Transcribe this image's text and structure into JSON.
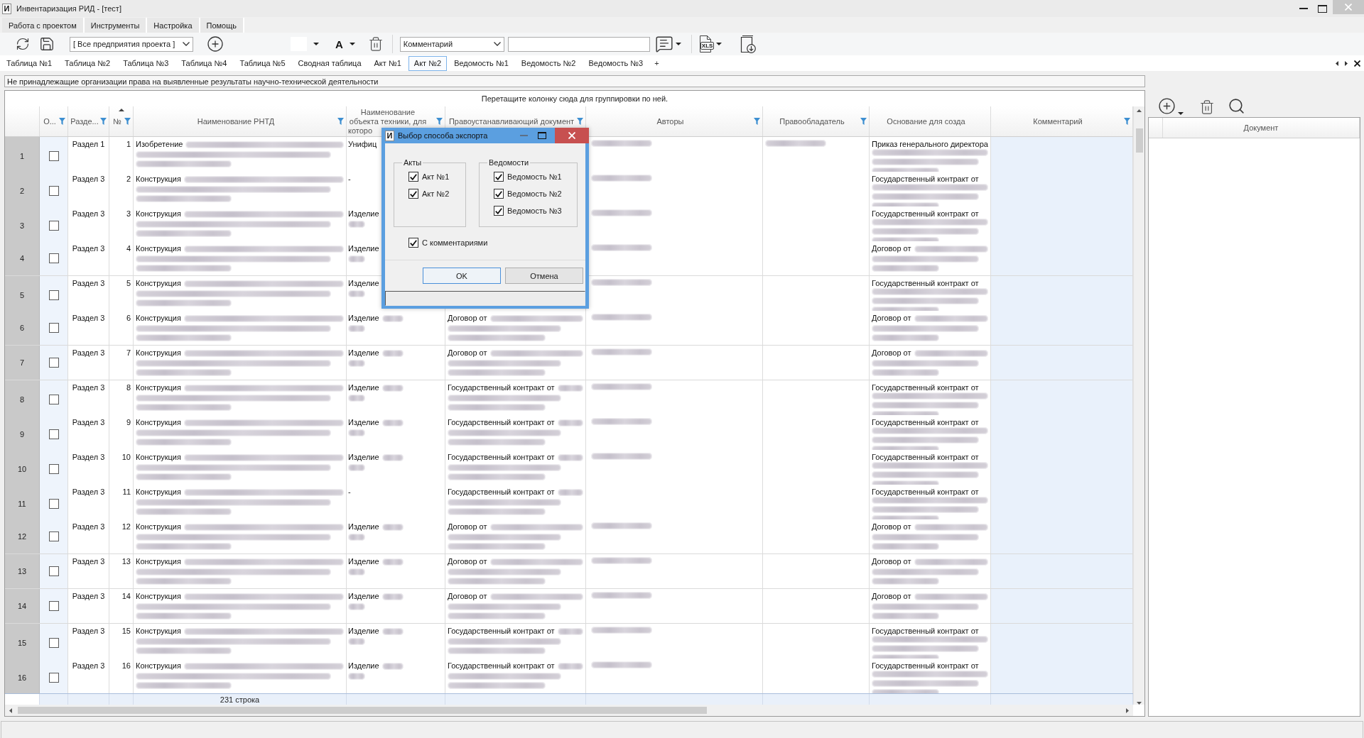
{
  "window": {
    "icon_letter": "И",
    "title": "Инвентаризация РИД - [тест]"
  },
  "menu": [
    "Работа с проектом",
    "Инструменты",
    "Настройка",
    "Помощь"
  ],
  "toolbar": {
    "project_filter": "[ Все предприятия проекта ]",
    "font_color": "A",
    "column_select": "Комментарий",
    "export_label": "XLS"
  },
  "tabs": [
    {
      "label": "Таблица №1",
      "selected": false
    },
    {
      "label": "Таблица №2",
      "selected": false
    },
    {
      "label": "Таблица №3",
      "selected": false
    },
    {
      "label": "Таблица №4",
      "selected": false
    },
    {
      "label": "Таблица №5",
      "selected": false
    },
    {
      "label": "Сводная таблица",
      "selected": false
    },
    {
      "label": "Акт №1",
      "selected": false
    },
    {
      "label": "Акт №2",
      "selected": true
    },
    {
      "label": "Ведомость №1",
      "selected": false
    },
    {
      "label": "Ведомость №2",
      "selected": false
    },
    {
      "label": "Ведомость №3",
      "selected": false
    }
  ],
  "add_tab": "+",
  "grid": {
    "caption": "Не принадлежащие организации права на выявленные результаты научно-технической деятельности",
    "group_hint": "Перетащите колонку сюда для группировки по ней.",
    "columns": [
      {
        "label": "О...",
        "filter": true,
        "sorted": false
      },
      {
        "label": "Разде...",
        "filter": true,
        "sorted": false
      },
      {
        "label": "№",
        "filter": true,
        "sorted": true
      },
      {
        "label": "Наименование РНТД",
        "filter": true,
        "sorted": false
      },
      {
        "label": "Наименование объекта техники, для которо",
        "filter": true,
        "sorted": false
      },
      {
        "label": "Правоустанавливающий документ",
        "filter": true,
        "sorted": false
      },
      {
        "label": "Авторы",
        "filter": true,
        "sorted": false
      },
      {
        "label": "Правообладатель",
        "filter": true,
        "sorted": false
      },
      {
        "label": "Основание для созда",
        "filter": false,
        "sorted": false
      },
      {
        "label": "Комментарий",
        "filter": true,
        "sorted": false
      }
    ],
    "rows": [
      {
        "number": "1",
        "checked": false,
        "section": "Раздел 1",
        "index": "1",
        "rntd": {
          "text": "Изобретение",
          "redacted": true
        },
        "object": {
          "text": "Унифиц"
        },
        "authors": {
          "redacted": true
        },
        "holder": {
          "redacted": true
        },
        "basis": {
          "text": "Приказ генерального директора",
          "redacted": true
        }
      },
      {
        "number": "2",
        "checked": false,
        "section": "Раздел 3",
        "index": "2",
        "rntd": {
          "text": "Конструкция",
          "redacted": true
        },
        "object": {
          "text": "-"
        },
        "authors": {
          "redacted": true
        },
        "basis": {
          "text": "Государственный контракт от",
          "redacted": true
        }
      },
      {
        "number": "3",
        "checked": false,
        "section": "Раздел 3",
        "index": "3",
        "rntd": {
          "text": "Конструкция",
          "redacted": true
        },
        "object": {
          "text": "Изделие",
          "redacted": true
        },
        "authors": {
          "redacted": true
        },
        "basis": {
          "text": "Государственный контракт от",
          "redacted": true
        }
      },
      {
        "number": "4",
        "checked": false,
        "section": "Раздел 3",
        "index": "4",
        "rntd": {
          "text": "Конструкция",
          "redacted": true
        },
        "object": {
          "text": "Изделие",
          "redacted": true
        },
        "authors": {
          "redacted": true
        },
        "basis": {
          "text": "Договор от",
          "redacted": true
        }
      },
      {
        "number": "5",
        "checked": false,
        "section": "Раздел 3",
        "index": "5",
        "rntd": {
          "text": "Конструкция",
          "redacted": true
        },
        "object": {
          "text": "Изделие",
          "redacted": true
        },
        "authors": {
          "redacted": true
        },
        "basis": {
          "text": "Государственный контракт от",
          "redacted": true
        }
      },
      {
        "number": "6",
        "checked": false,
        "section": "Раздел 3",
        "index": "6",
        "rntd": {
          "text": "Конструкция",
          "redacted": true
        },
        "object": {
          "text": "Изделие",
          "redacted": true
        },
        "document": {
          "text": "Договор от",
          "redacted": true
        },
        "authors": {
          "redacted": true
        },
        "basis": {
          "text": "Договор от",
          "redacted": true
        }
      },
      {
        "number": "7",
        "checked": false,
        "section": "Раздел 3",
        "index": "7",
        "rntd": {
          "text": "Конструкция",
          "redacted": true
        },
        "object": {
          "text": "Изделие",
          "redacted": true
        },
        "document": {
          "text": "Договор от",
          "redacted": true
        },
        "authors": {
          "redacted": true
        },
        "basis": {
          "text": "Договор от",
          "redacted": true
        }
      },
      {
        "number": "8",
        "checked": false,
        "section": "Раздел 3",
        "index": "8",
        "rntd": {
          "text": "Конструкция",
          "redacted": true
        },
        "object": {
          "text": "Изделие",
          "redacted": true
        },
        "document": {
          "text": "Государственный контракт от",
          "redacted": true
        },
        "authors": {
          "redacted": true
        },
        "basis": {
          "text": "Государственный контракт от",
          "redacted": true
        }
      },
      {
        "number": "9",
        "checked": false,
        "section": "Раздел 3",
        "index": "9",
        "rntd": {
          "text": "Конструкция",
          "redacted": true
        },
        "object": {
          "text": "Изделие",
          "redacted": true
        },
        "document": {
          "text": "Государственный контракт от",
          "redacted": true
        },
        "authors": {
          "redacted": true
        },
        "basis": {
          "text": "Государственный контракт от",
          "redacted": true
        }
      },
      {
        "number": "10",
        "checked": false,
        "section": "Раздел 3",
        "index": "10",
        "rntd": {
          "text": "Конструкция",
          "redacted": true
        },
        "object": {
          "text": "Изделие",
          "redacted": true
        },
        "document": {
          "text": "Государственный контракт от",
          "redacted": true
        },
        "authors": {
          "redacted": true
        },
        "basis": {
          "text": "Государственный контракт от",
          "redacted": true
        }
      },
      {
        "number": "11",
        "checked": false,
        "section": "Раздел 3",
        "index": "11",
        "rntd": {
          "text": "Конструкция",
          "redacted": true
        },
        "object": {
          "text": "-"
        },
        "document": {
          "text": "Государственный контракт от",
          "redacted": true
        },
        "basis": {
          "text": "Государственный контракт от",
          "redacted": true
        }
      },
      {
        "number": "12",
        "checked": false,
        "section": "Раздел 3",
        "index": "12",
        "rntd": {
          "text": "Конструкция",
          "redacted": true
        },
        "object": {
          "text": "Изделие",
          "redacted": true
        },
        "document": {
          "text": "Договор от",
          "redacted": true
        },
        "authors": {
          "redacted": true
        },
        "basis": {
          "text": "Договор от",
          "redacted": true
        }
      },
      {
        "number": "13",
        "checked": false,
        "section": "Раздел 3",
        "index": "13",
        "rntd": {
          "text": "Конструкция",
          "redacted": true
        },
        "object": {
          "text": "Изделие",
          "redacted": true
        },
        "document": {
          "text": "Договор от",
          "redacted": true
        },
        "authors": {
          "redacted": true
        },
        "basis": {
          "text": "Договор от",
          "redacted": true
        }
      },
      {
        "number": "14",
        "checked": false,
        "section": "Раздел 3",
        "index": "14",
        "rntd": {
          "text": "Конструкция",
          "redacted": true
        },
        "object": {
          "text": "Изделие",
          "redacted": true
        },
        "document": {
          "text": "Договор от",
          "redacted": true
        },
        "authors": {
          "redacted": true
        },
        "basis": {
          "text": "Договор от",
          "redacted": true
        }
      },
      {
        "number": "15",
        "checked": false,
        "section": "Раздел 3",
        "index": "15",
        "rntd": {
          "text": "Конструкция",
          "redacted": true
        },
        "object": {
          "text": "Изделие",
          "redacted": true
        },
        "document": {
          "text": "Государственный контракт от",
          "redacted": true
        },
        "authors": {
          "redacted": true
        },
        "basis": {
          "text": "Государственный контракт от",
          "redacted": true
        }
      },
      {
        "number": "16",
        "checked": false,
        "section": "Раздел 3",
        "index": "16",
        "rntd": {
          "text": "Конструкция",
          "redacted": true
        },
        "object": {
          "text": "Изделие",
          "redacted": true
        },
        "document": {
          "text": "Государственный контракт от",
          "redacted": true
        },
        "authors": {
          "redacted": true
        },
        "basis": {
          "text": "Государственный контракт от",
          "redacted": true
        }
      }
    ],
    "footer": "231 строка"
  },
  "side_panel": {
    "columns": [
      "Документ"
    ]
  },
  "dialog": {
    "icon_letter": "И",
    "title": "Выбор способа экспорта",
    "groups": [
      {
        "title": "Акты",
        "items": [
          {
            "label": "Акт №1",
            "checked": true
          },
          {
            "label": "Акт №2",
            "checked": true
          }
        ]
      },
      {
        "title": "Ведомости",
        "items": [
          {
            "label": "Ведомость №1",
            "checked": true
          },
          {
            "label": "Ведомость №2",
            "checked": true
          },
          {
            "label": "Ведомость №3",
            "checked": true
          }
        ]
      }
    ],
    "comments": {
      "label": "С комментариями",
      "checked": true
    },
    "buttons": [
      {
        "label": "OK",
        "focused": true
      },
      {
        "label": "Отмена",
        "focused": false
      }
    ]
  }
}
